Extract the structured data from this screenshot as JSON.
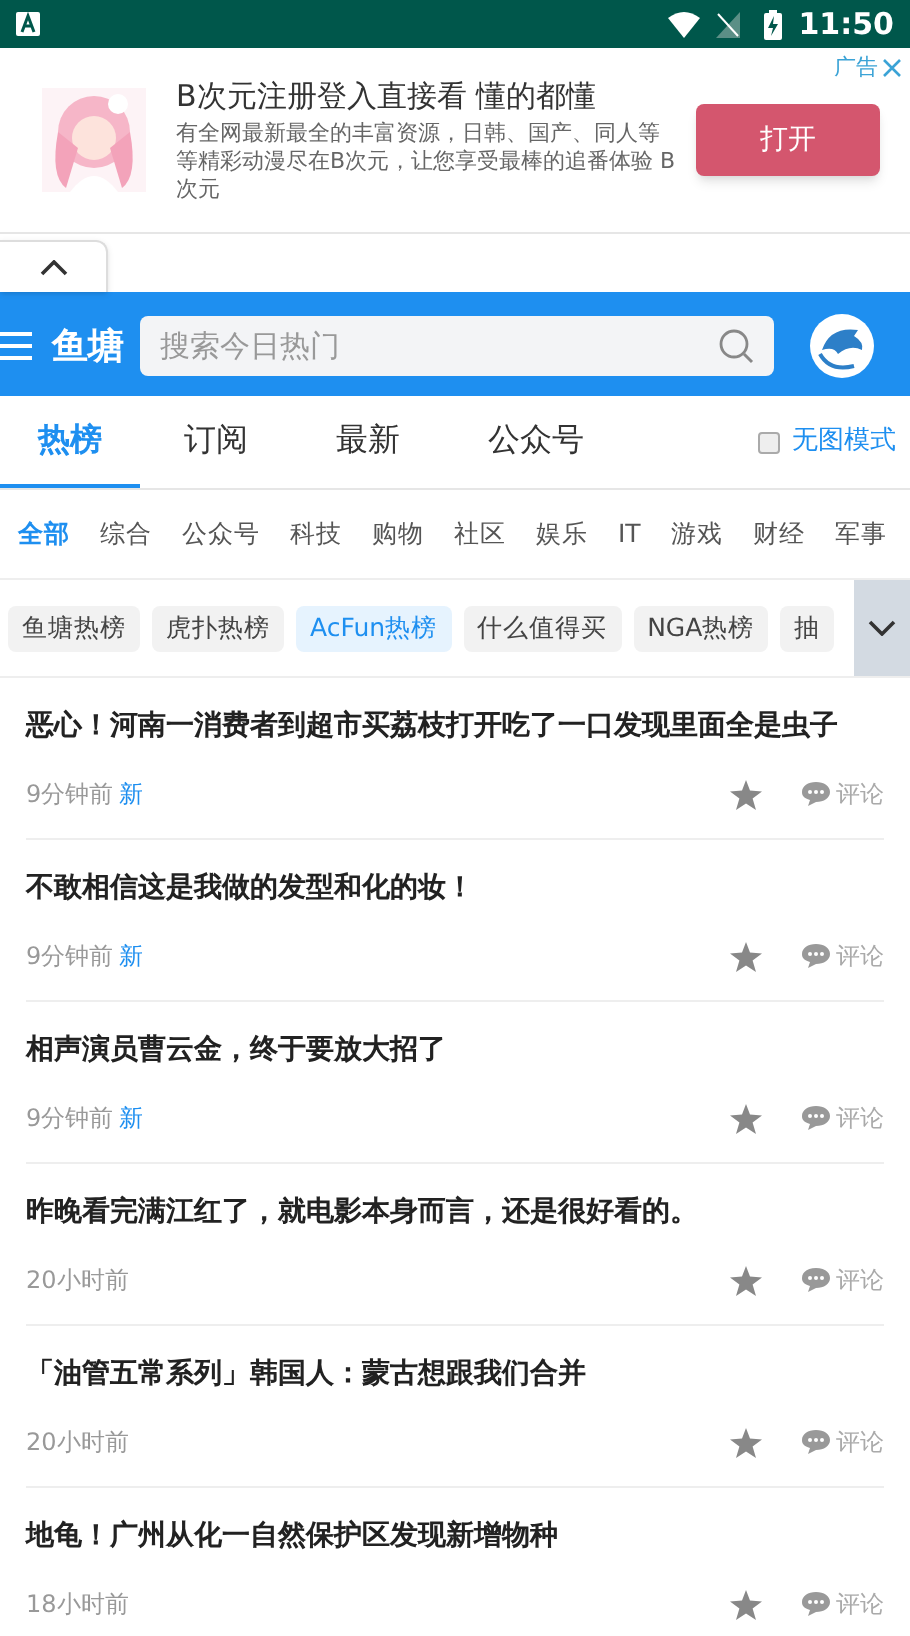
{
  "status_bar": {
    "time": "11:50"
  },
  "ad": {
    "title": "B次元注册登入直接看 懂的都懂",
    "description": "有全网最新最全的丰富资源，日韩、国产、同人等等精彩动漫尽在B次元，让您享受最棒的追番体验 B次元",
    "button": "打开",
    "label": "广告"
  },
  "header": {
    "logo": "鱼塘",
    "search": {
      "placeholder": "搜索今日热门"
    }
  },
  "tabs": [
    {
      "label": "热榜",
      "selected": true
    },
    {
      "label": "订阅",
      "selected": false
    },
    {
      "label": "最新",
      "selected": false
    },
    {
      "label": "公众号",
      "selected": false
    }
  ],
  "no_image_mode": {
    "label": "无图模式",
    "checked": false
  },
  "categories": [
    {
      "label": "全部",
      "selected": true
    },
    {
      "label": "综合",
      "selected": false
    },
    {
      "label": "公众号",
      "selected": false
    },
    {
      "label": "科技",
      "selected": false
    },
    {
      "label": "购物",
      "selected": false
    },
    {
      "label": "社区",
      "selected": false
    },
    {
      "label": "娱乐",
      "selected": false
    },
    {
      "label": "IT",
      "selected": false
    },
    {
      "label": "游戏",
      "selected": false
    },
    {
      "label": "财经",
      "selected": false
    },
    {
      "label": "军事",
      "selected": false
    }
  ],
  "sources": [
    {
      "label": "鱼塘热榜",
      "selected": false
    },
    {
      "label": "虎扑热榜",
      "selected": false
    },
    {
      "label": "AcFun热榜",
      "selected": true
    },
    {
      "label": "什么值得买",
      "selected": false
    },
    {
      "label": "NGA热榜",
      "selected": false
    },
    {
      "label": "抽",
      "selected": false
    }
  ],
  "articles": [
    {
      "title": "恶心！河南一消费者到超市买荔枝打开吃了一口发现里面全是虫子",
      "time": "9分钟前",
      "badge": "新",
      "comment": "评论"
    },
    {
      "title": "不敢相信这是我做的发型和化的妆！",
      "time": "9分钟前",
      "badge": "新",
      "comment": "评论"
    },
    {
      "title": "相声演员曹云金，终于要放大招了",
      "time": "9分钟前",
      "badge": "新",
      "comment": "评论"
    },
    {
      "title": "昨晚看完满江红了，就电影本身而言，还是很好看的。",
      "time": "20小时前",
      "comment": "评论"
    },
    {
      "title": "「油管五常系列」韩国人：蒙古想跟我们合并",
      "time": "20小时前",
      "comment": "评论"
    },
    {
      "title": "地龟！广州从化一自然保护区发现新增物种",
      "time": "18小时前",
      "comment": "评论"
    }
  ]
}
